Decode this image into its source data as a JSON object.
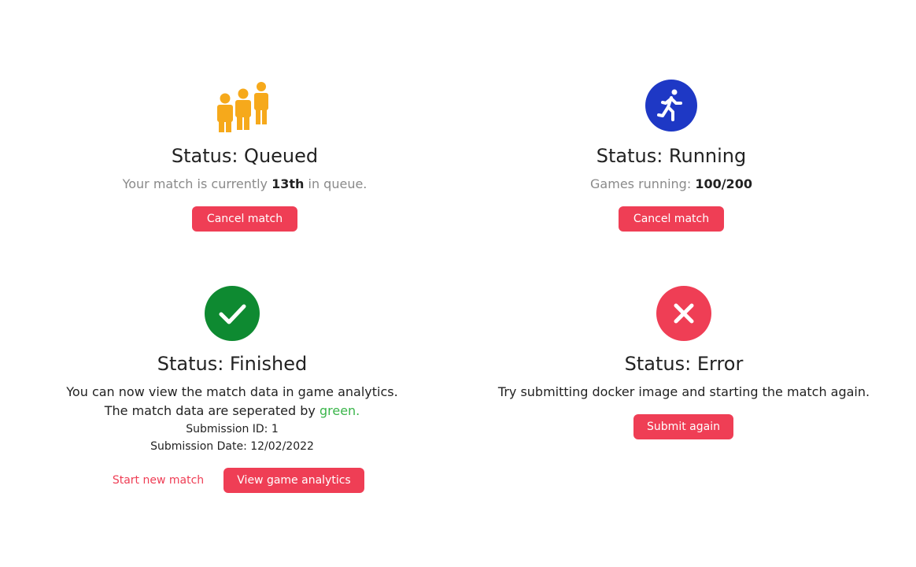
{
  "colors": {
    "queued_icon": "#f6a91b",
    "running_icon": "#1e38c5",
    "finished_icon": "#0e8a31",
    "error_icon": "#ef3e55",
    "button": "#ef3e55",
    "muted_text": "#8a8a8a",
    "green_text": "#3ab54a"
  },
  "queued": {
    "icon": "people-queue-icon",
    "title": "Status: Queued",
    "desc_pre": "Your match is currently ",
    "desc_rank": "13th",
    "desc_post": " in queue.",
    "cancel_label": "Cancel match"
  },
  "running": {
    "icon": "running-person-icon",
    "title": "Status: Running",
    "desc_label": "Games running: ",
    "desc_value": "100/200",
    "cancel_label": "Cancel match"
  },
  "finished": {
    "icon": "checkmark-icon",
    "title": "Status: Finished",
    "line1": "You can now view the match data in game analytics.",
    "line2_pre": "The match data are seperated by ",
    "line2_green": "green.",
    "submission_id": "Submission ID: 1",
    "submission_date": "Submission Date: 12/02/2022",
    "start_new_label": "Start new match",
    "view_analytics_label": "View game analytics"
  },
  "error": {
    "icon": "x-icon",
    "title": "Status: Error",
    "desc": "Try submitting docker image and starting the match again.",
    "submit_label": "Submit again"
  }
}
